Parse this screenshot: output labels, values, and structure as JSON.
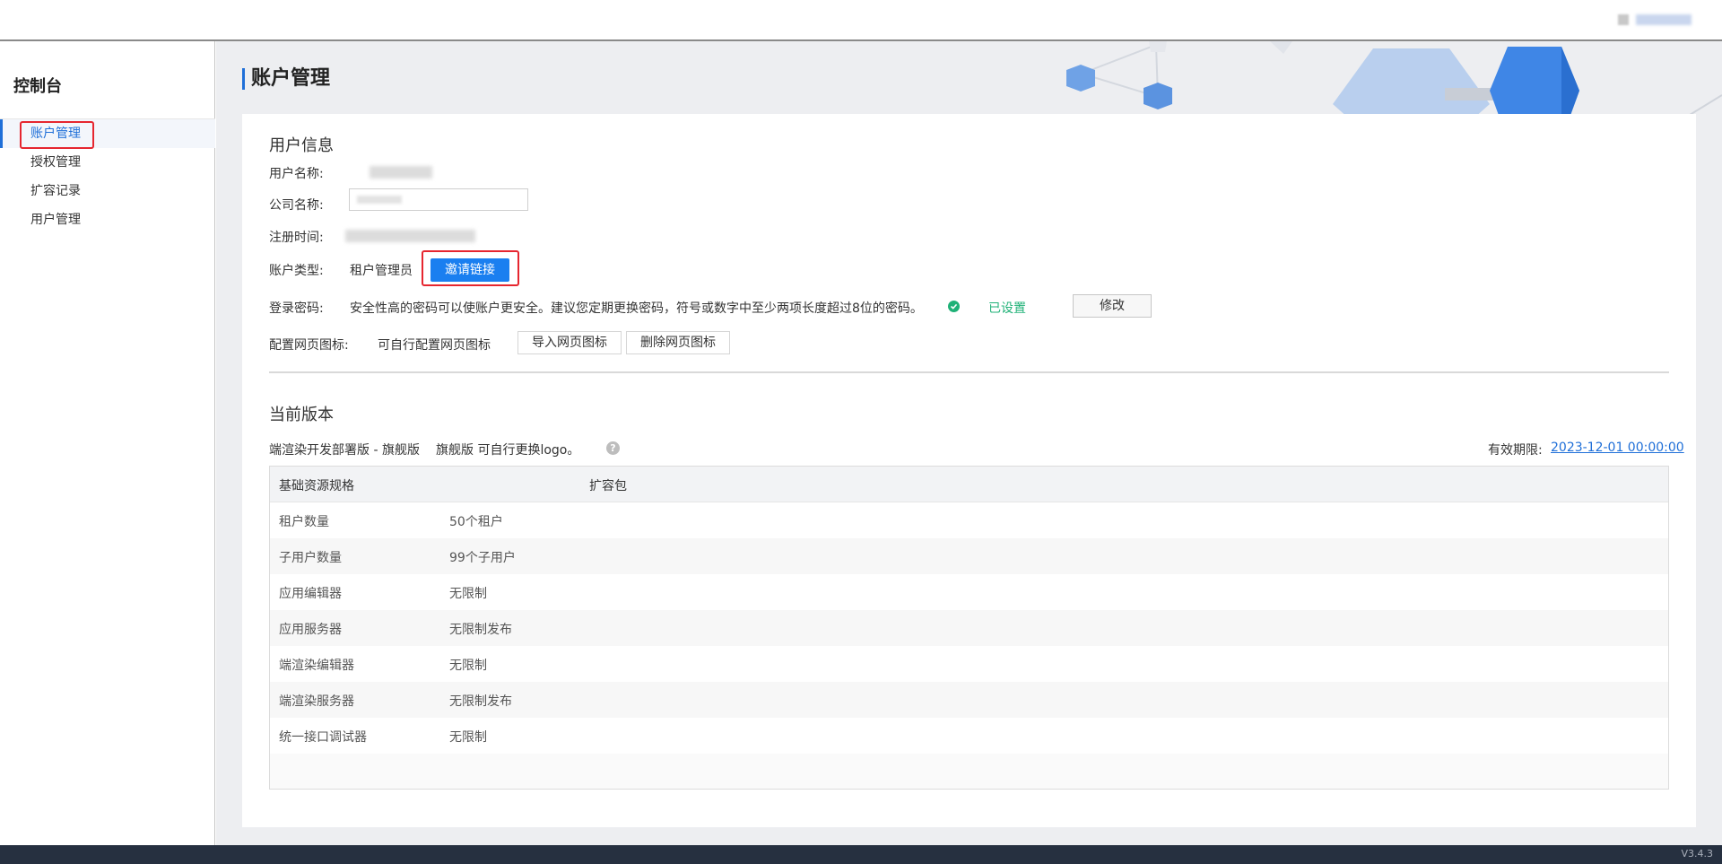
{
  "sidebar": {
    "title": "控制台",
    "items": [
      {
        "label": "账户管理",
        "active": true
      },
      {
        "label": "授权管理",
        "active": false
      },
      {
        "label": "扩容记录",
        "active": false
      },
      {
        "label": "用户管理",
        "active": false
      }
    ]
  },
  "page": {
    "title": "账户管理"
  },
  "user_info": {
    "section_title": "用户信息",
    "username_label": "用户名称:",
    "company_label": "公司名称:",
    "register_label": "注册时间:",
    "account_type_label": "账户类型:",
    "account_type_value": "租户管理员",
    "invite_button": "邀请链接",
    "password_label": "登录密码:",
    "password_hint": "安全性高的密码可以使账户更安全。建议您定期更换密码，符号或数字中至少两项长度超过8位的密码。",
    "password_status": "已设置",
    "modify_button": "修改",
    "favicon_label": "配置网页图标:",
    "favicon_hint": "可自行配置网页图标",
    "import_favicon_button": "导入网页图标",
    "delete_favicon_button": "删除网页图标"
  },
  "version": {
    "section_title": "当前版本",
    "edition": "端渲染开发部署版 - 旗舰版",
    "edition_note": "旗舰版 可自行更换logo。",
    "expiry_label": "有效期限:",
    "expiry_value": "2023-12-01 00:00:00",
    "table": {
      "headers": [
        "基础资源规格",
        "扩容包"
      ],
      "rows": [
        {
          "name": "租户数量",
          "value": "50个租户"
        },
        {
          "name": "子用户数量",
          "value": "99个子用户"
        },
        {
          "name": "应用编辑器",
          "value": "无限制"
        },
        {
          "name": "应用服务器",
          "value": "无限制发布"
        },
        {
          "name": "端渲染编辑器",
          "value": "无限制"
        },
        {
          "name": "端渲染服务器",
          "value": "无限制发布"
        },
        {
          "name": "统一接口调试器",
          "value": "无限制"
        }
      ]
    }
  },
  "footer": {
    "version": "V3.4.3"
  },
  "colors": {
    "accent": "#1a7ff0",
    "success": "#1fb177",
    "highlight": "#e6262f",
    "footer_bg": "#263040"
  }
}
